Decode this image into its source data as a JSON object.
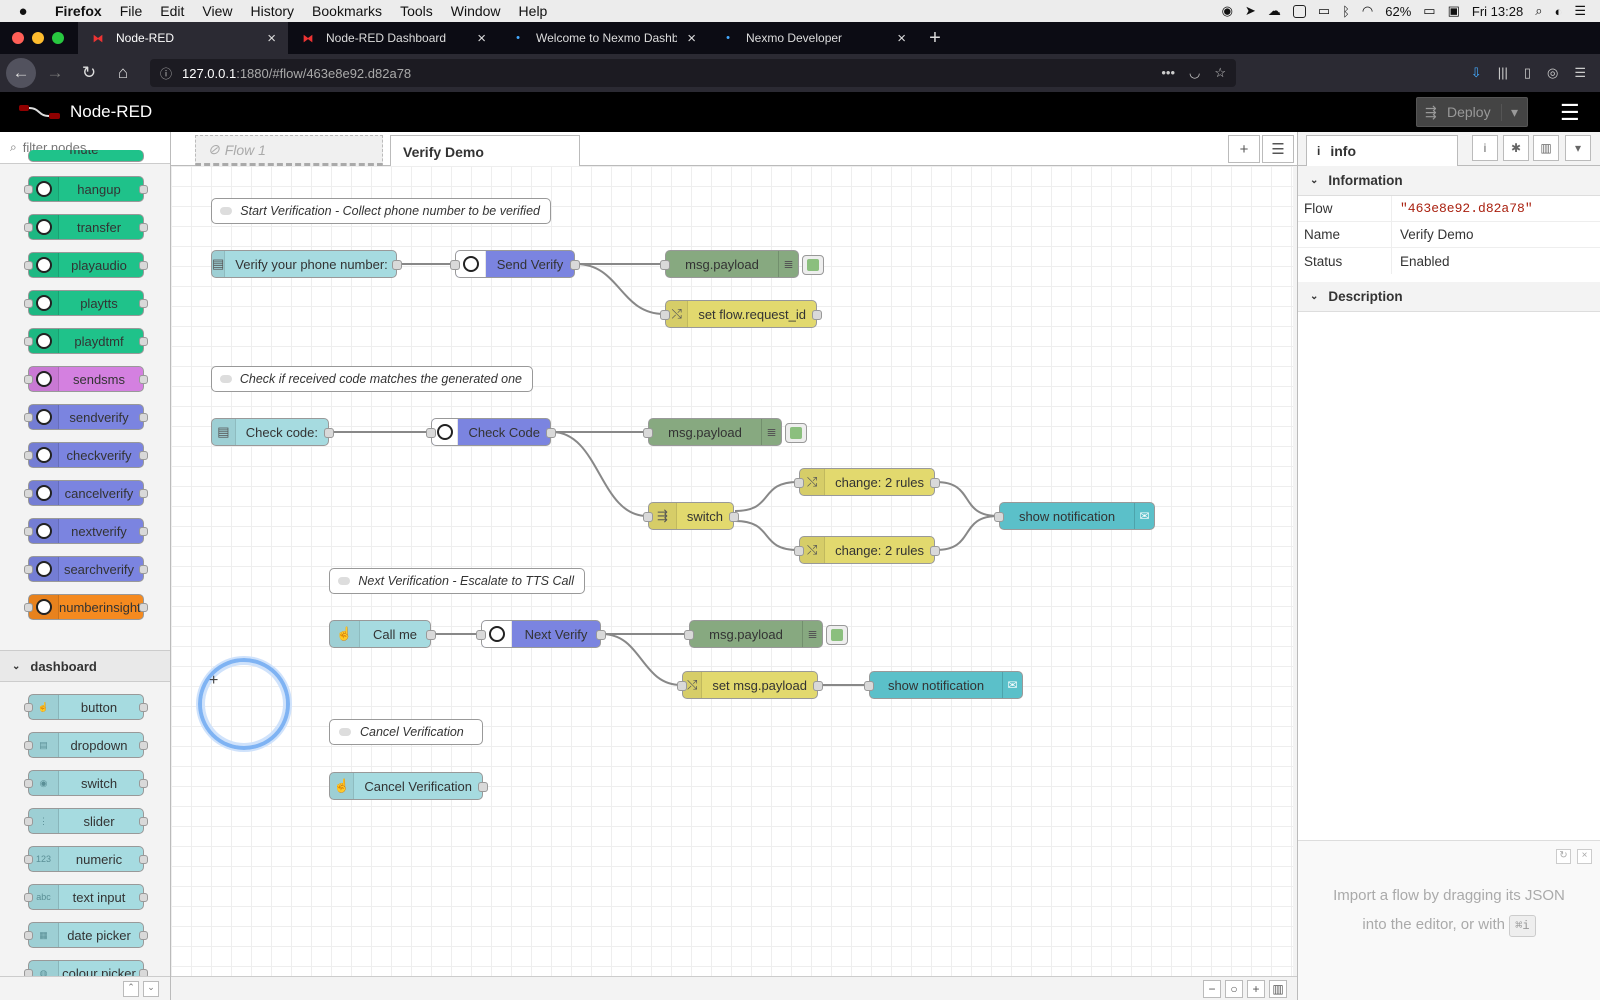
{
  "menubar": {
    "app": "Firefox",
    "items": [
      "File",
      "Edit",
      "View",
      "History",
      "Bookmarks",
      "Tools",
      "Window",
      "Help"
    ],
    "battery": "62%",
    "clock": "Fri 13:28"
  },
  "browser_tabs": [
    {
      "title": "Node-RED",
      "active": true
    },
    {
      "title": "Node-RED Dashboard",
      "active": false
    },
    {
      "title": "Welcome to Nexmo Dashboard",
      "active": false
    },
    {
      "title": "Nexmo Developer",
      "active": false
    }
  ],
  "urlbar": {
    "host": "127.0.0.1",
    "path": ":1880/#flow/463e8e92.d82a78"
  },
  "header": {
    "title": "Node-RED",
    "deploy_label": "Deploy"
  },
  "palette": {
    "filter_placeholder": "filter nodes",
    "top_partial_label": "mute",
    "nexmo_nodes": [
      {
        "label": "hangup",
        "color": "#1fc28a"
      },
      {
        "label": "transfer",
        "color": "#1fc28a"
      },
      {
        "label": "playaudio",
        "color": "#1fc28a"
      },
      {
        "label": "playtts",
        "color": "#1fc28a"
      },
      {
        "label": "playdtmf",
        "color": "#1fc28a"
      },
      {
        "label": "sendsms",
        "color": "#d480e0"
      },
      {
        "label": "sendverify",
        "color": "#7b84e0"
      },
      {
        "label": "checkverify",
        "color": "#7b84e0"
      },
      {
        "label": "cancelverify",
        "color": "#7b84e0"
      },
      {
        "label": "nextverify",
        "color": "#7b84e0"
      },
      {
        "label": "searchverify",
        "color": "#7b84e0"
      },
      {
        "label": "numberinsight",
        "color": "#f58a1f"
      }
    ],
    "category": "dashboard",
    "dashboard_nodes": [
      {
        "label": "button",
        "icon": "hand-pointer-icon",
        "glyph": "☝"
      },
      {
        "label": "dropdown",
        "icon": "list-icon",
        "glyph": "▤"
      },
      {
        "label": "switch",
        "icon": "toggle-icon",
        "glyph": "◉"
      },
      {
        "label": "slider",
        "icon": "sliders-icon",
        "glyph": "⋮"
      },
      {
        "label": "numeric",
        "icon": "numeric-icon",
        "glyph": "123"
      },
      {
        "label": "text input",
        "icon": "text-input-icon",
        "glyph": "abc"
      },
      {
        "label": "date picker",
        "icon": "calendar-icon",
        "glyph": "▦"
      },
      {
        "label": "colour picker",
        "icon": "palette-icon",
        "glyph": "◍"
      }
    ],
    "dashboard_color": "#a6dbe0"
  },
  "workspace": {
    "tabs": [
      {
        "label": "Flow 1",
        "disabled": true
      },
      {
        "label": "Verify Demo",
        "active": true
      }
    ]
  },
  "flow": {
    "comments": [
      {
        "id": "c1",
        "label": "Start Verification - Collect phone number to be verified"
      },
      {
        "id": "c2",
        "label": "Check if received code matches the generated one"
      },
      {
        "id": "c3",
        "label": "Next Verification - Escalate to TTS Call"
      },
      {
        "id": "c4",
        "label": "Cancel Verification"
      }
    ],
    "nodes": [
      {
        "id": "n1",
        "label": "Verify your phone number:",
        "type": "form",
        "color": "#a6dbe0"
      },
      {
        "id": "n2",
        "label": "Send Verify",
        "type": "nexmo",
        "color": "#7b84e0"
      },
      {
        "id": "n3",
        "label": "msg.payload",
        "type": "debug",
        "color": "#87a980"
      },
      {
        "id": "n4",
        "label": "set flow.request_id",
        "type": "change",
        "color": "#e2d96e"
      },
      {
        "id": "n5",
        "label": "Check code:",
        "type": "form",
        "color": "#a6dbe0"
      },
      {
        "id": "n6",
        "label": "Check Code",
        "type": "nexmo",
        "color": "#7b84e0"
      },
      {
        "id": "n7",
        "label": "msg.payload",
        "type": "debug",
        "color": "#87a980"
      },
      {
        "id": "n8",
        "label": "switch",
        "type": "switch",
        "color": "#e2d96e"
      },
      {
        "id": "n9",
        "label": "change: 2 rules",
        "type": "change",
        "color": "#e2d96e"
      },
      {
        "id": "n10",
        "label": "change: 2 rules",
        "type": "change",
        "color": "#e2d96e"
      },
      {
        "id": "n11",
        "label": "show notification",
        "type": "notification",
        "color": "#5bc0c9"
      },
      {
        "id": "n12",
        "label": "Call me",
        "type": "button",
        "color": "#a6dbe0"
      },
      {
        "id": "n13",
        "label": "Next Verify",
        "type": "nexmo",
        "color": "#7b84e0"
      },
      {
        "id": "n14",
        "label": "msg.payload",
        "type": "debug",
        "color": "#87a980"
      },
      {
        "id": "n15",
        "label": "set msg.payload",
        "type": "change",
        "color": "#e2d96e"
      },
      {
        "id": "n16",
        "label": "show notification",
        "type": "notification",
        "color": "#5bc0c9"
      },
      {
        "id": "n17",
        "label": "Cancel Verification",
        "type": "button",
        "color": "#a6dbe0"
      }
    ],
    "wires": [
      [
        "n1",
        "n2"
      ],
      [
        "n2",
        "n3"
      ],
      [
        "n2",
        "n4"
      ],
      [
        "n5",
        "n6"
      ],
      [
        "n6",
        "n7"
      ],
      [
        "n6",
        "n8"
      ],
      [
        "n8",
        "n9"
      ],
      [
        "n8",
        "n10"
      ],
      [
        "n9",
        "n11"
      ],
      [
        "n10",
        "n11"
      ],
      [
        "n12",
        "n13"
      ],
      [
        "n13",
        "n14"
      ],
      [
        "n13",
        "n15"
      ],
      [
        "n15",
        "n16"
      ]
    ]
  },
  "sidebar": {
    "tab_label": "info",
    "info_section": "Information",
    "rows": [
      {
        "key": "Flow",
        "value": "\"463e8e92.d82a78\""
      },
      {
        "key": "Name",
        "value": "Verify Demo"
      },
      {
        "key": "Status",
        "value": "Enabled"
      }
    ],
    "description_section": "Description",
    "help_line1": "Import a flow by dragging its JSON",
    "help_line2": "into the editor, or with",
    "help_kbd": "⌘i"
  }
}
